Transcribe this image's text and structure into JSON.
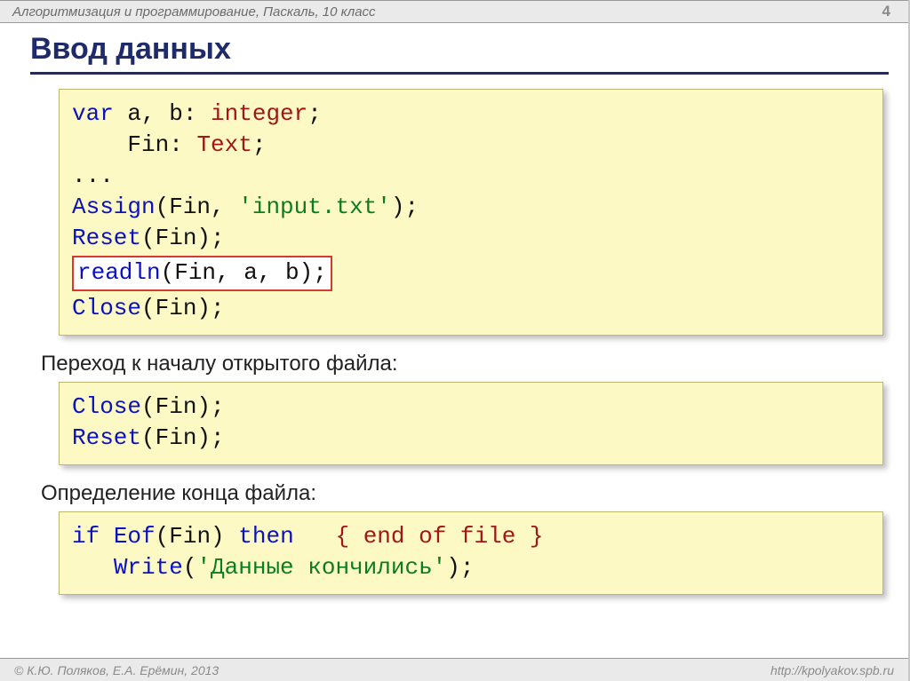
{
  "header": {
    "breadcrumb": "Алгоритмизация и программирование, Паскаль, 10 класс",
    "page_number": "4"
  },
  "title": "Ввод данных",
  "block1": {
    "l1_var": "var",
    "l1_rest": " a, b: ",
    "l1_type": "integer",
    "l1_semi": ";",
    "l2_pad": "    Fin: ",
    "l2_type": "Text",
    "l2_semi": ";",
    "l3": "...",
    "l4_fn": "Assign",
    "l4_rest": "(Fin, ",
    "l4_str": "'input.txt'",
    "l4_end": ");",
    "l5_fn": "Reset",
    "l5_rest": "(Fin);",
    "l6_fn": "readln",
    "l6_rest": "(Fin, a, b);",
    "l7_fn": "Close",
    "l7_rest": "(Fin);"
  },
  "sub1": "Переход к началу открытого файла:",
  "block2": {
    "l1_fn": "Close",
    "l1_rest": "(Fin);",
    "l2_fn": "Reset",
    "l2_rest": "(Fin);"
  },
  "sub2": "Определение конца файла:",
  "block3": {
    "l1_if": "if",
    "l1_sp1": " ",
    "l1_fn": "Eof",
    "l1_arg": "(Fin) ",
    "l1_then": "then",
    "l1_sp2": "   ",
    "l1_cmt": "{ end of file }",
    "l2_pad": "   ",
    "l2_fn": "Write",
    "l2_open": "(",
    "l2_str": "'Данные кончились'",
    "l2_end": ");"
  },
  "footer": {
    "left": "© К.Ю. Поляков, Е.А. Ерёмин, 2013",
    "right": "http://kpolyakov.spb.ru"
  }
}
